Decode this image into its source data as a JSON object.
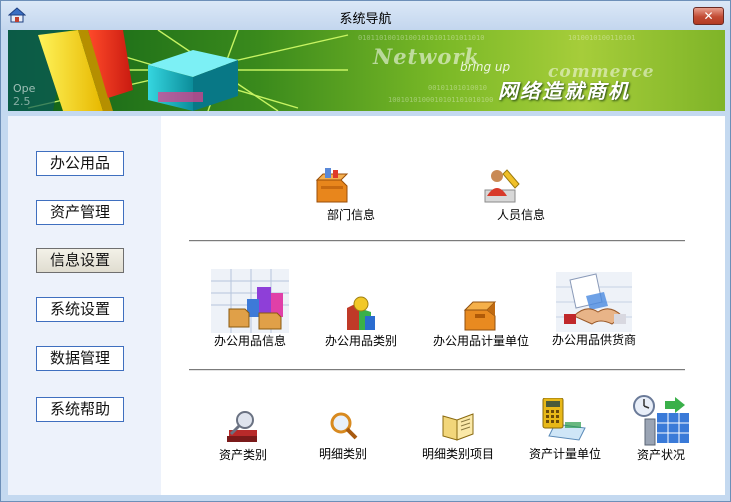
{
  "window": {
    "title": "系统导航",
    "close_label": "✕"
  },
  "banner": {
    "title_en": "Network",
    "subtitle_en": "bring up",
    "word_en": "commerce",
    "title_cn": "网络造就商机"
  },
  "sidebar": {
    "items": [
      {
        "label": "办公用品",
        "active": false
      },
      {
        "label": "资产管理",
        "active": false
      },
      {
        "label": "信息设置",
        "active": true
      },
      {
        "label": "系统设置",
        "active": false
      },
      {
        "label": "数据管理",
        "active": false
      },
      {
        "label": "系统帮助",
        "active": false
      }
    ]
  },
  "main": {
    "group1": [
      {
        "label": "部门信息",
        "icon": "department-icon"
      },
      {
        "label": "人员信息",
        "icon": "person-icon"
      }
    ],
    "group2": [
      {
        "label": "办公用品信息",
        "icon": "office-supplies-info-icon"
      },
      {
        "label": "办公用品类别",
        "icon": "office-supplies-category-icon"
      },
      {
        "label": "办公用品计量单位",
        "icon": "office-supplies-unit-icon"
      },
      {
        "label": "办公用品供货商",
        "icon": "supplier-handshake-icon"
      }
    ],
    "group3": [
      {
        "label": "资产类别",
        "icon": "asset-category-icon"
      },
      {
        "label": "明细类别",
        "icon": "detail-category-icon"
      },
      {
        "label": "明细类别项目",
        "icon": "detail-item-book-icon"
      },
      {
        "label": "资产计量单位",
        "icon": "calculator-icon"
      },
      {
        "label": "资产状况",
        "icon": "asset-status-icon"
      }
    ]
  }
}
